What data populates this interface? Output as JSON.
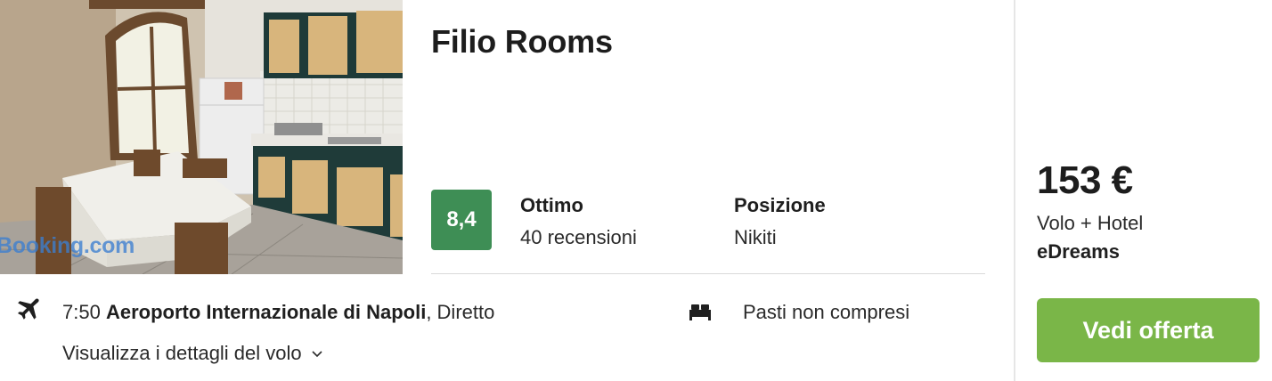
{
  "hotel": {
    "name": "Filio Rooms",
    "photo_watermark": "Booking.com"
  },
  "rating": {
    "score": "8,4",
    "label": "Ottimo",
    "reviews": "40 recensioni",
    "score_color": "#3e8e55"
  },
  "location": {
    "label": "Posizione",
    "value": "Nikiti"
  },
  "flight": {
    "time": "7:50",
    "airport": "Aeroporto Internazionale di Napoli",
    "type": ", Diretto",
    "details_link": "Visualizza i dettagli del volo",
    "icon": "airplane-icon"
  },
  "meals": {
    "text": "Pasti non compresi",
    "icon": "bed-icon"
  },
  "offer": {
    "price": "153 €",
    "package": "Volo + Hotel",
    "provider": "eDreams",
    "cta_label": "Vedi offerta",
    "cta_color": "#7ab648"
  }
}
